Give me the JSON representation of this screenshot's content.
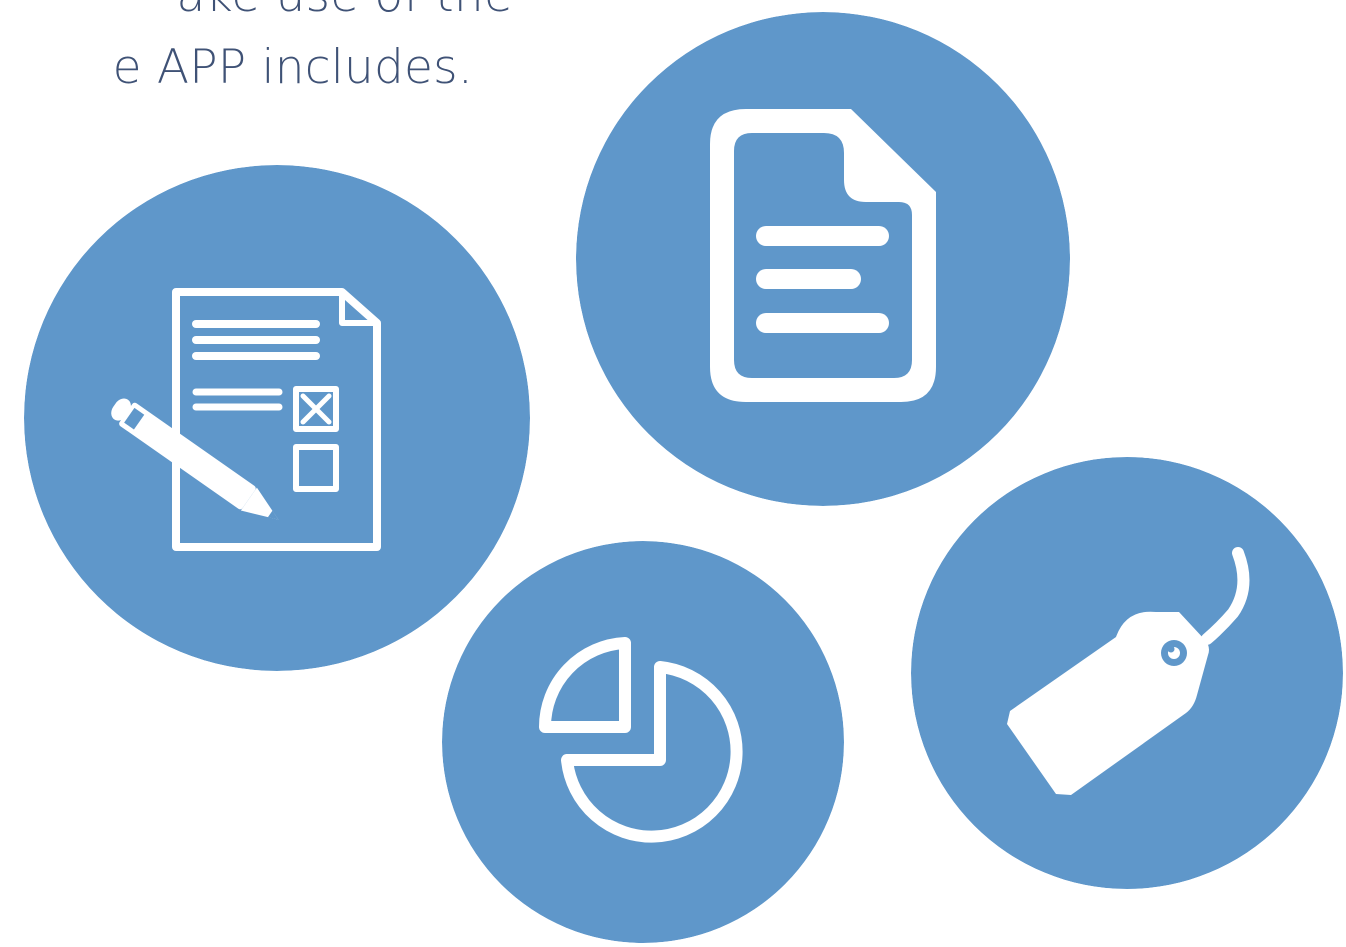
{
  "headline": {
    "line_1": "ake use of the",
    "line_2": "e APP includes."
  },
  "colors": {
    "text": "#3f5276",
    "circle_fill": "#5f97ca",
    "icon": "#ffffff",
    "background": "#ffffff"
  },
  "features": [
    {
      "icon": "form-with-pencil-icon"
    },
    {
      "icon": "document-icon"
    },
    {
      "icon": "pie-chart-icon"
    },
    {
      "icon": "price-tag-icon"
    }
  ]
}
